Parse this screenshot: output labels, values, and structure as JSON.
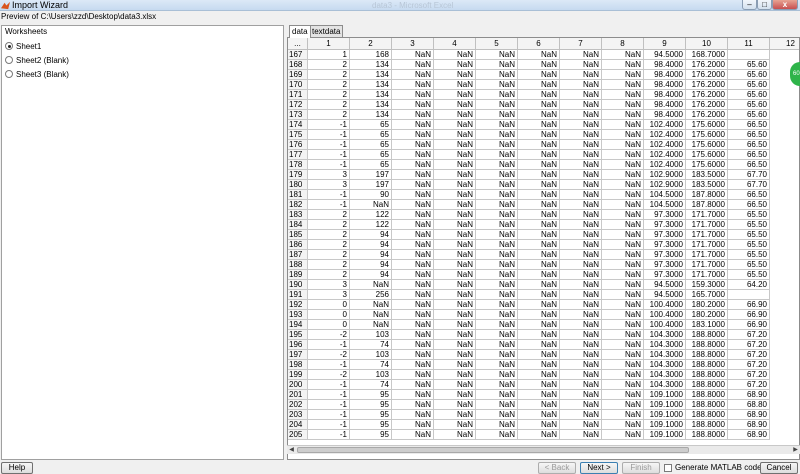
{
  "window": {
    "title": "Import Wizard",
    "ghost_title": "data3 - Microsoft Excel",
    "min_label": "–",
    "max_label": "□",
    "close_label": "x"
  },
  "preview_label": "Preview of C:\\Users\\zzd\\Desktop\\data3.xlsx",
  "worksheets": {
    "header": "Worksheets",
    "items": [
      {
        "label": "Sheet1",
        "selected": true
      },
      {
        "label": "Sheet2 (Blank)",
        "selected": false
      },
      {
        "label": "Sheet3 (Blank)",
        "selected": false
      }
    ]
  },
  "tabs": [
    {
      "label": "data",
      "active": true
    },
    {
      "label": "textdata",
      "active": false
    }
  ],
  "table": {
    "corner": "...",
    "columns": [
      "1",
      "2",
      "3",
      "4",
      "5",
      "6",
      "7",
      "8",
      "9",
      "10",
      "11",
      "12"
    ],
    "rows": [
      [
        "167",
        "1",
        "168",
        "NaN",
        "NaN",
        "NaN",
        "NaN",
        "NaN",
        "NaN",
        "94.5000",
        "168.7000",
        ""
      ],
      [
        "168",
        "2",
        "134",
        "NaN",
        "NaN",
        "NaN",
        "NaN",
        "NaN",
        "NaN",
        "98.4000",
        "176.2000",
        "65.60"
      ],
      [
        "169",
        "2",
        "134",
        "NaN",
        "NaN",
        "NaN",
        "NaN",
        "NaN",
        "NaN",
        "98.4000",
        "176.2000",
        "65.60"
      ],
      [
        "170",
        "2",
        "134",
        "NaN",
        "NaN",
        "NaN",
        "NaN",
        "NaN",
        "NaN",
        "98.4000",
        "176.2000",
        "65.60"
      ],
      [
        "171",
        "2",
        "134",
        "NaN",
        "NaN",
        "NaN",
        "NaN",
        "NaN",
        "NaN",
        "98.4000",
        "176.2000",
        "65.60"
      ],
      [
        "172",
        "2",
        "134",
        "NaN",
        "NaN",
        "NaN",
        "NaN",
        "NaN",
        "NaN",
        "98.4000",
        "176.2000",
        "65.60"
      ],
      [
        "173",
        "2",
        "134",
        "NaN",
        "NaN",
        "NaN",
        "NaN",
        "NaN",
        "NaN",
        "98.4000",
        "176.2000",
        "65.60"
      ],
      [
        "174",
        "-1",
        "65",
        "NaN",
        "NaN",
        "NaN",
        "NaN",
        "NaN",
        "NaN",
        "102.4000",
        "175.6000",
        "66.50"
      ],
      [
        "175",
        "-1",
        "65",
        "NaN",
        "NaN",
        "NaN",
        "NaN",
        "NaN",
        "NaN",
        "102.4000",
        "175.6000",
        "66.50"
      ],
      [
        "176",
        "-1",
        "65",
        "NaN",
        "NaN",
        "NaN",
        "NaN",
        "NaN",
        "NaN",
        "102.4000",
        "175.6000",
        "66.50"
      ],
      [
        "177",
        "-1",
        "65",
        "NaN",
        "NaN",
        "NaN",
        "NaN",
        "NaN",
        "NaN",
        "102.4000",
        "175.6000",
        "66.50"
      ],
      [
        "178",
        "-1",
        "65",
        "NaN",
        "NaN",
        "NaN",
        "NaN",
        "NaN",
        "NaN",
        "102.4000",
        "175.6000",
        "66.50"
      ],
      [
        "179",
        "3",
        "197",
        "NaN",
        "NaN",
        "NaN",
        "NaN",
        "NaN",
        "NaN",
        "102.9000",
        "183.5000",
        "67.70"
      ],
      [
        "180",
        "3",
        "197",
        "NaN",
        "NaN",
        "NaN",
        "NaN",
        "NaN",
        "NaN",
        "102.9000",
        "183.5000",
        "67.70"
      ],
      [
        "181",
        "-1",
        "90",
        "NaN",
        "NaN",
        "NaN",
        "NaN",
        "NaN",
        "NaN",
        "104.5000",
        "187.8000",
        "66.50"
      ],
      [
        "182",
        "-1",
        "NaN",
        "NaN",
        "NaN",
        "NaN",
        "NaN",
        "NaN",
        "NaN",
        "104.5000",
        "187.8000",
        "66.50"
      ],
      [
        "183",
        "2",
        "122",
        "NaN",
        "NaN",
        "NaN",
        "NaN",
        "NaN",
        "NaN",
        "97.3000",
        "171.7000",
        "65.50"
      ],
      [
        "184",
        "2",
        "122",
        "NaN",
        "NaN",
        "NaN",
        "NaN",
        "NaN",
        "NaN",
        "97.3000",
        "171.7000",
        "65.50"
      ],
      [
        "185",
        "2",
        "94",
        "NaN",
        "NaN",
        "NaN",
        "NaN",
        "NaN",
        "NaN",
        "97.3000",
        "171.7000",
        "65.50"
      ],
      [
        "186",
        "2",
        "94",
        "NaN",
        "NaN",
        "NaN",
        "NaN",
        "NaN",
        "NaN",
        "97.3000",
        "171.7000",
        "65.50"
      ],
      [
        "187",
        "2",
        "94",
        "NaN",
        "NaN",
        "NaN",
        "NaN",
        "NaN",
        "NaN",
        "97.3000",
        "171.7000",
        "65.50"
      ],
      [
        "188",
        "2",
        "94",
        "NaN",
        "NaN",
        "NaN",
        "NaN",
        "NaN",
        "NaN",
        "97.3000",
        "171.7000",
        "65.50"
      ],
      [
        "189",
        "2",
        "94",
        "NaN",
        "NaN",
        "NaN",
        "NaN",
        "NaN",
        "NaN",
        "97.3000",
        "171.7000",
        "65.50"
      ],
      [
        "190",
        "3",
        "NaN",
        "NaN",
        "NaN",
        "NaN",
        "NaN",
        "NaN",
        "NaN",
        "94.5000",
        "159.3000",
        "64.20"
      ],
      [
        "191",
        "3",
        "256",
        "NaN",
        "NaN",
        "NaN",
        "NaN",
        "NaN",
        "NaN",
        "94.5000",
        "165.7000",
        ""
      ],
      [
        "192",
        "0",
        "NaN",
        "NaN",
        "NaN",
        "NaN",
        "NaN",
        "NaN",
        "NaN",
        "100.4000",
        "180.2000",
        "66.90"
      ],
      [
        "193",
        "0",
        "NaN",
        "NaN",
        "NaN",
        "NaN",
        "NaN",
        "NaN",
        "NaN",
        "100.4000",
        "180.2000",
        "66.90"
      ],
      [
        "194",
        "0",
        "NaN",
        "NaN",
        "NaN",
        "NaN",
        "NaN",
        "NaN",
        "NaN",
        "100.4000",
        "183.1000",
        "66.90"
      ],
      [
        "195",
        "-2",
        "103",
        "NaN",
        "NaN",
        "NaN",
        "NaN",
        "NaN",
        "NaN",
        "104.3000",
        "188.8000",
        "67.20"
      ],
      [
        "196",
        "-1",
        "74",
        "NaN",
        "NaN",
        "NaN",
        "NaN",
        "NaN",
        "NaN",
        "104.3000",
        "188.8000",
        "67.20"
      ],
      [
        "197",
        "-2",
        "103",
        "NaN",
        "NaN",
        "NaN",
        "NaN",
        "NaN",
        "NaN",
        "104.3000",
        "188.8000",
        "67.20"
      ],
      [
        "198",
        "-1",
        "74",
        "NaN",
        "NaN",
        "NaN",
        "NaN",
        "NaN",
        "NaN",
        "104.3000",
        "188.8000",
        "67.20"
      ],
      [
        "199",
        "-2",
        "103",
        "NaN",
        "NaN",
        "NaN",
        "NaN",
        "NaN",
        "NaN",
        "104.3000",
        "188.8000",
        "67.20"
      ],
      [
        "200",
        "-1",
        "74",
        "NaN",
        "NaN",
        "NaN",
        "NaN",
        "NaN",
        "NaN",
        "104.3000",
        "188.8000",
        "67.20"
      ],
      [
        "201",
        "-1",
        "95",
        "NaN",
        "NaN",
        "NaN",
        "NaN",
        "NaN",
        "NaN",
        "109.1000",
        "188.8000",
        "68.90"
      ],
      [
        "202",
        "-1",
        "95",
        "NaN",
        "NaN",
        "NaN",
        "NaN",
        "NaN",
        "NaN",
        "109.1000",
        "188.8000",
        "68.80"
      ],
      [
        "203",
        "-1",
        "95",
        "NaN",
        "NaN",
        "NaN",
        "NaN",
        "NaN",
        "NaN",
        "109.1000",
        "188.8000",
        "68.90"
      ],
      [
        "204",
        "-1",
        "95",
        "NaN",
        "NaN",
        "NaN",
        "NaN",
        "NaN",
        "NaN",
        "109.1000",
        "188.8000",
        "68.90"
      ],
      [
        "205",
        "-1",
        "95",
        "NaN",
        "NaN",
        "NaN",
        "NaN",
        "NaN",
        "NaN",
        "109.1000",
        "188.8000",
        "68.90"
      ]
    ]
  },
  "footer": {
    "help": "Help",
    "back": "< Back",
    "next": "Next >",
    "finish": "Finish",
    "generate_code": "Generate MATLAB code",
    "cancel": "Cancel"
  },
  "colors": {
    "accent": "#3c7fb1",
    "float_button": "#2fb44a",
    "close_button": "#c75050"
  }
}
